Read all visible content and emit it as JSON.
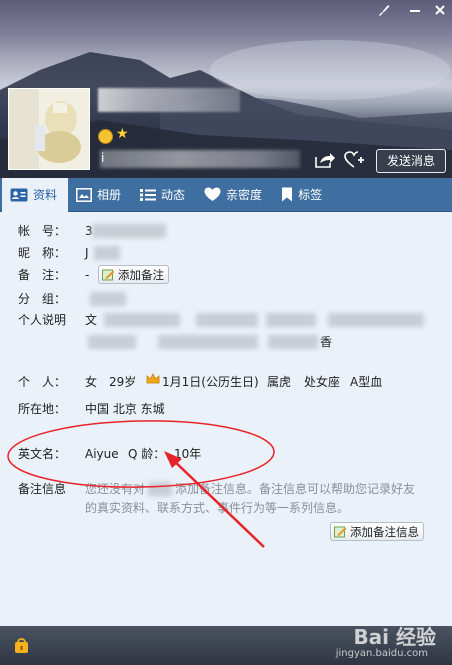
{
  "header": {
    "send_message": "发送消息",
    "signature_initial": "i"
  },
  "tabs": [
    {
      "label": "资料",
      "icon": "profile-card-icon"
    },
    {
      "label": "相册",
      "icon": "photo-album-icon"
    },
    {
      "label": "动态",
      "icon": "feed-list-icon"
    },
    {
      "label": "亲密度",
      "icon": "heart-icon"
    },
    {
      "label": "标签",
      "icon": "bookmark-tag-icon"
    }
  ],
  "profile": {
    "account_label": "帐　号：",
    "account_prefix": "3",
    "nickname_label": "昵　称：",
    "nickname_prefix": "J",
    "remark_label": "备　注：",
    "remark_value": "-",
    "add_remark": "添加备注",
    "group_label": "分　组：",
    "bio_label": "个人说明",
    "bio_prefix": "文",
    "bio_tail": "香",
    "personal_label": "个　人：",
    "gender": "女",
    "age": "29岁",
    "birthday": "1月1日(公历生日)",
    "zodiac": "属虎",
    "constellation": "处女座",
    "blood_type": "A型血",
    "location_label": "所在地：",
    "location": "中国 北京 东城",
    "english_label": "英文名：",
    "english_name": "Aiyue",
    "qage_label": "Q 龄：",
    "qage": "10年",
    "note_label": "备注信息",
    "note_line1_a": "您还没有对",
    "note_line1_b": "添加备注信息。备注信息可以帮助您记录好友",
    "note_line2": "的真实资料、联系方式、事件行为等一系列信息。",
    "add_remark_info": "添加备注信息"
  },
  "watermark": {
    "brand": "Bai 经验",
    "url": "jingyan.baidu.com"
  },
  "colors": {
    "tab_bar": "#3f6fa0",
    "active_tab_text": "#2a64a6",
    "content_bg": "#eaf1f8",
    "annotation_red": "#e8232a"
  }
}
